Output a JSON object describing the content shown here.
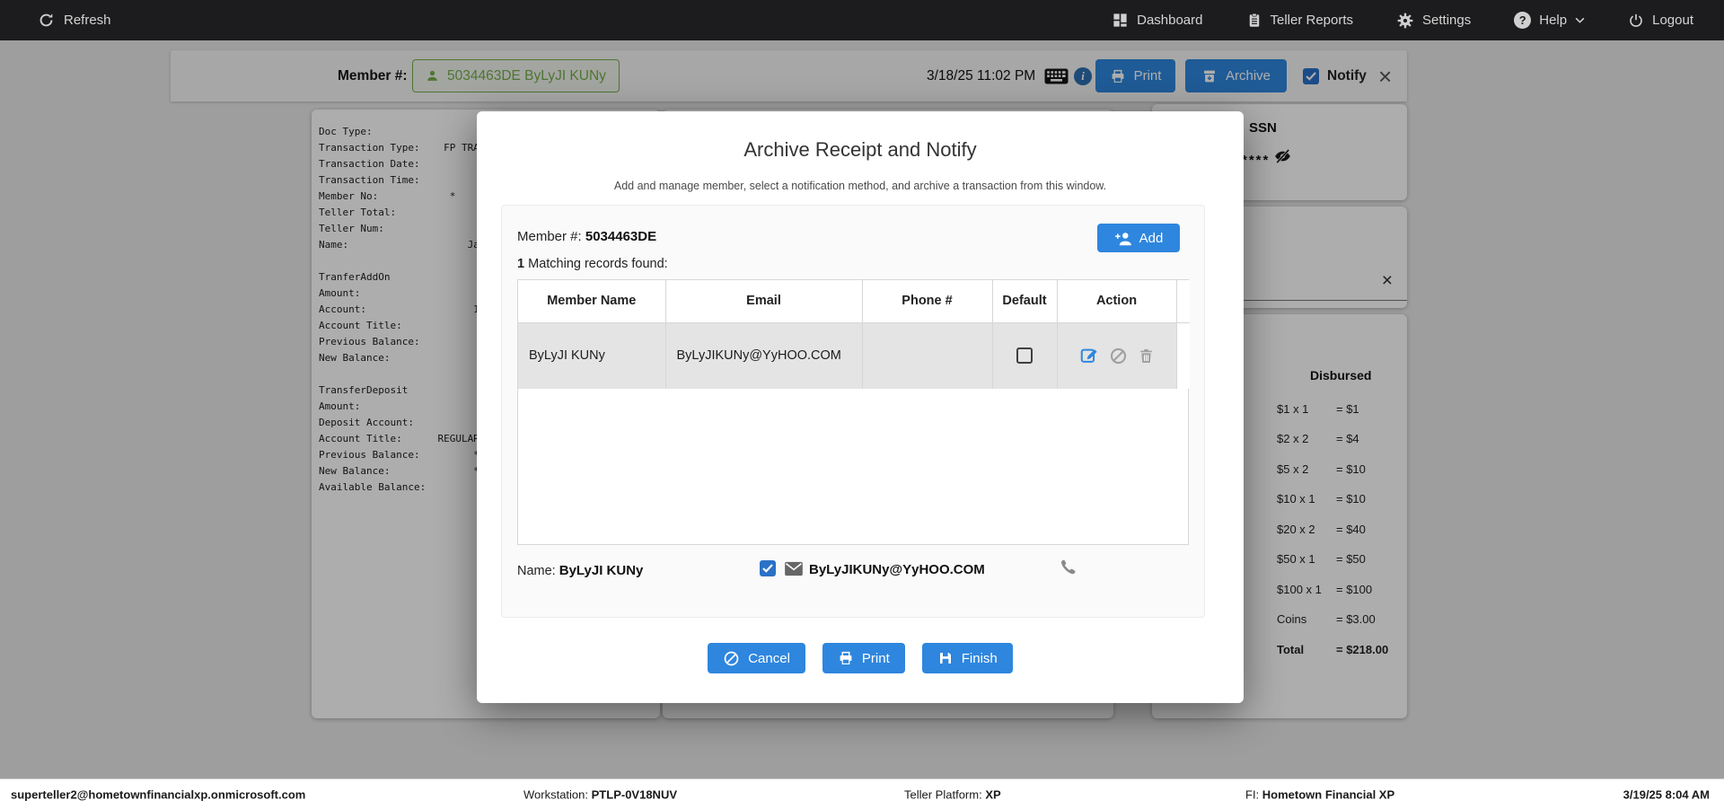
{
  "navbar": {
    "refresh": "Refresh",
    "items": [
      {
        "label": "Dashboard"
      },
      {
        "label": "Teller Reports"
      },
      {
        "label": "Settings"
      },
      {
        "label": "Help"
      },
      {
        "label": "Logout"
      }
    ],
    "help_glyph": "?"
  },
  "member_bar": {
    "label": "Member #:",
    "member_chip": "5034463DE ByLyJI KUNy",
    "datetime": "3/18/25 11:02 PM",
    "info_glyph": "i",
    "print_label": "Print",
    "archive_label": "Archive",
    "notify_label": "Notify",
    "close": "×"
  },
  "receipt_text": "Doc Type:\nTransaction Type:    FP TRA\nTransaction Date:\nTransaction Time:\nMember No:            *\nTeller Total:\nTeller Num:\nName:                    Ja\n\nTranferAddOn\nAmount:\nAccount:                  1\nAccount Title:\nPrevious Balance:\nNew Balance:\n\nTransferDeposit\nAmount:\nDeposit Account:\nAccount Title:      REGULAR\nPrevious Balance:         *\nNew Balance:              *\nAvailable Balance:",
  "right_panel": {
    "ssn_label": "SSN",
    "ssn_masked": "****",
    "close": "×",
    "disbursed_title": "Disbursed",
    "denominations": [
      {
        "label": "$1 x 1",
        "amount": "= $1"
      },
      {
        "label": "$2 x 2",
        "amount": "= $4"
      },
      {
        "label": "$5 x 2",
        "amount": "= $10"
      },
      {
        "label": "$10 x 1",
        "amount": "= $10"
      },
      {
        "label": "$20 x 2",
        "amount": "= $40"
      },
      {
        "label": "$50 x 1",
        "amount": "= $50"
      },
      {
        "label": "$100 x 1",
        "amount": "= $100"
      },
      {
        "label": "Coins",
        "amount": "= $3.00"
      },
      {
        "label": "Total",
        "amount": "= $218.00"
      }
    ]
  },
  "modal": {
    "title": "Archive Receipt and Notify",
    "subtitle": "Add and manage member, select a notification method, and archive a transaction from this window.",
    "member_label": "Member #:",
    "member_number": "5034463DE",
    "records_count": "1",
    "records_label": "Matching records found:",
    "add_label": "Add",
    "table": {
      "headers": [
        "Member Name",
        "Email",
        "Phone #",
        "Default",
        "Action"
      ],
      "row": {
        "name": "ByLyJI KUNy",
        "email": "ByLyJIKUNy@YyHOO.COM",
        "phone": ""
      }
    },
    "name_label": "Name:",
    "name_value": "ByLyJI KUNy",
    "notify_email": "ByLyJIKUNy@YyHOO.COM",
    "cancel_label": "Cancel",
    "print_label": "Print",
    "finish_label": "Finish"
  },
  "status_bar": {
    "user": "superteller2@hometownfinancialxp.onmicrosoft.com",
    "workstation_label": "Workstation:",
    "workstation_value": "PTLP-0V18NUV",
    "platform_label": "Teller Platform:",
    "platform_value": "XP",
    "fi_label": "FI:",
    "fi_value": "Hometown Financial XP",
    "datetime": "3/19/25 8:04 AM"
  },
  "colors": {
    "primary_blue": "#2e86de",
    "chip_green": "#74ad49",
    "navbar_bg": "#1c1c1e",
    "row_gray": "#e4e4e4"
  }
}
